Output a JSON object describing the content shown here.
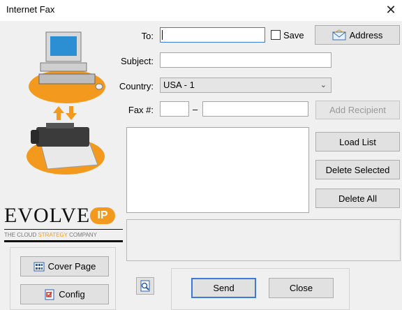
{
  "window": {
    "title": "Internet Fax",
    "close_glyph": "✕"
  },
  "form": {
    "to_label": "To:",
    "to_value": "",
    "save_label": "Save",
    "save_checked": false,
    "address_button": "Address",
    "subject_label": "Subject:",
    "subject_value": "",
    "country_label": "Country:",
    "country_value": "USA - 1",
    "fax_label": "Fax #:",
    "fax_area_value": "",
    "fax_separator": "–",
    "fax_number_value": "",
    "add_recipient_button": "Add Recipient"
  },
  "recipients": {
    "items": [],
    "load_list_button": "Load List",
    "delete_selected_button": "Delete Selected",
    "delete_all_button": "Delete All"
  },
  "logo": {
    "brand": "EVOLVE",
    "ip": "IP",
    "tagline_pre": "THE CLOUD ",
    "tagline_strategy": "STRATEGY",
    "tagline_post": " COMPANY"
  },
  "side_buttons": {
    "cover_page": "Cover Page",
    "config": "Config"
  },
  "footer": {
    "send_button": "Send",
    "close_button": "Close"
  },
  "icons": {
    "close": "close-icon",
    "address": "envelope-icon",
    "cover_page": "grid-page-icon",
    "config": "config-document-icon",
    "preview": "magnify-page-icon"
  },
  "colors": {
    "focus_border": "#3b7ad9",
    "accent_orange": "#f39a1e"
  }
}
